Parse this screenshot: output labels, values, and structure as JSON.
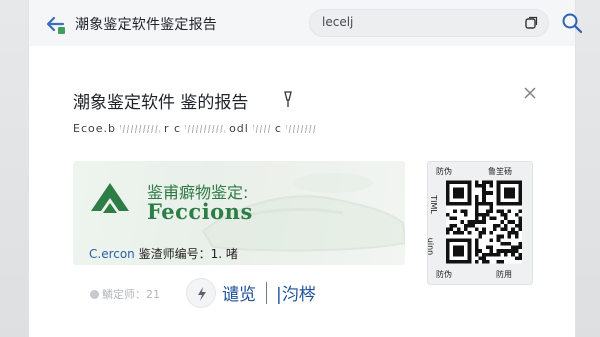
{
  "topbar": {
    "title": "潮象鉴定软件鉴定报告",
    "search_value": "lecelj"
  },
  "dialog": {
    "title": "潮象鉴定软件 鉴的报告",
    "subtitle_parts": [
      "Ecoe.b",
      "r c",
      "odl",
      "c"
    ]
  },
  "certificate": {
    "heading": "鉴甫癖物鉴定:",
    "brand": "Feccions",
    "code_en": "C.ercon",
    "code_label": " 鉴渣师编号：",
    "code_value": "1. 啫"
  },
  "footer": {
    "badge_text": "鱗定师：21",
    "link_1": "谴览",
    "link_2": "|汮梣"
  },
  "qr": {
    "top_left": "防伪",
    "top_right": "鲁䇠砀",
    "side_top": "TIML",
    "side_bottom": "uinn",
    "bottom_left": "防伪",
    "bottom_right": "防用"
  },
  "colors": {
    "accent_green": "#2d7d47",
    "link_blue": "#1d4f9a",
    "search_blue": "#2d62b5"
  },
  "icons": {
    "back": "back-arrow-icon",
    "tab": "tab-copy-icon",
    "search": "search-icon",
    "close": "close-icon",
    "share": "flash-icon",
    "logo": "brand-logo-icon"
  }
}
